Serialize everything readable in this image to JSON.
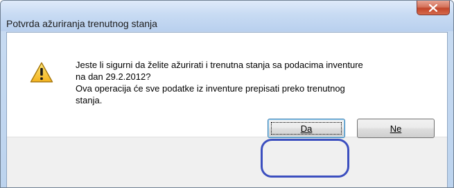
{
  "window": {
    "title": "Potvrda ažuriranja trenutnog stanja"
  },
  "message": {
    "lines": [
      "Jeste li sigurni da želite ažurirati i trenutna stanja sa podacima inventure",
      "na dan 29.2.2012?",
      "Ova operacija će sve podatke iz inventure prepisati preko trenutnog",
      "stanja."
    ]
  },
  "buttons": {
    "yes_label": "Da",
    "no_label": "Ne"
  },
  "icons": {
    "warning": "warning-icon",
    "close": "close-icon"
  },
  "colors": {
    "highlight": "#3c4fbf",
    "close_button": "#c2452a"
  }
}
